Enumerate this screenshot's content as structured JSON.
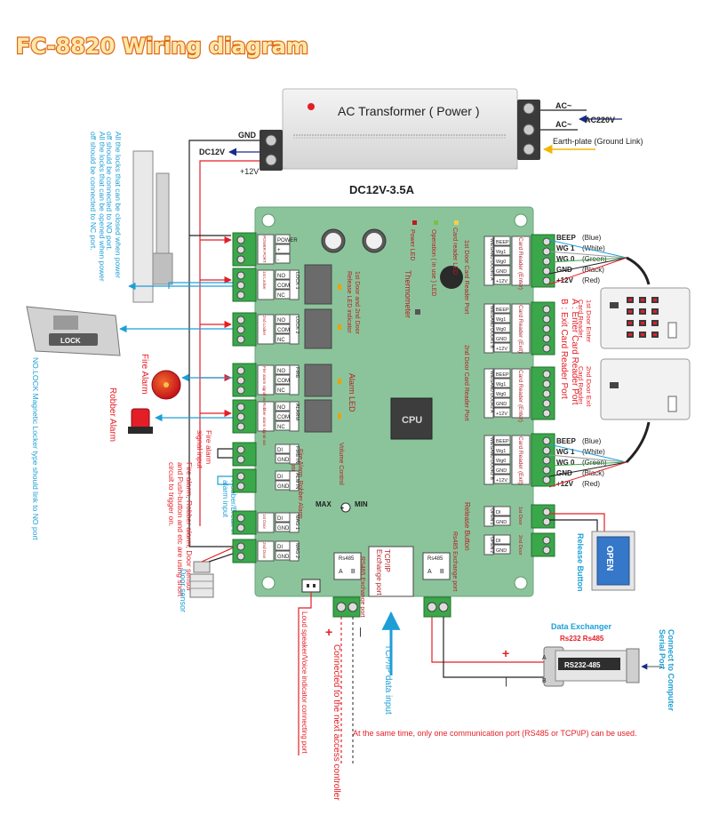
{
  "title": "FC-8820 Wiring diagram",
  "transformer": {
    "label": "AC Transformer ( Power )",
    "rating": "DC12V-3.5A",
    "left_terminals": {
      "gnd": "GND",
      "dc12v": "DC12V",
      "plus12v": "+12V"
    },
    "right_labels": {
      "ac1": "AC~",
      "ac2": "AC~",
      "ac220": "AC220V",
      "earth": "Earth-plate (Ground Link)"
    }
  },
  "left_notes": {
    "nc_note": "All the locks that can be opened when power off should be connected to NC port",
    "no_note": "All the locks that can be closed when power off should be connected to NO port.",
    "nolock_note": "NO.LOCK Magnetic Locker type should link to NO port",
    "lock_label": "LOCK",
    "fire_alarm": "Fire Alarm",
    "robber_alarm": "Robber Alarm",
    "fire_signal": "Fire alarm signal input",
    "robber_input": "Robber/Break-in alarm input",
    "trigger_note": "Fire alarm, Robber alarm, Door sensor and Push-button and etc are using short circuit to trigger on.",
    "door_sensor": "Door sensor"
  },
  "pcb": {
    "left_terminals": [
      {
        "id": "power",
        "pins": [
          "POWER",
          "+",
          "-"
        ],
        "side_label": "POWER PORT"
      },
      {
        "id": "lock1",
        "pins": [
          "NO",
          "COM",
          "NC"
        ],
        "side_label": "1st Locker",
        "tag": "LOCK 1"
      },
      {
        "id": "lock2",
        "pins": [
          "NO",
          "COM",
          "NC"
        ],
        "side_label": "2nd Locker",
        "tag": "LOCK 2"
      },
      {
        "id": "fire",
        "pins": [
          "NO",
          "COM",
          "NC"
        ],
        "side_label": "Fire alarm signal out",
        "tag": "FIRE"
      },
      {
        "id": "alarm",
        "pins": [
          "NO",
          "COM",
          "NC"
        ],
        "side_label": "Robber alarm signal out",
        "tag": "ALARM"
      },
      {
        "id": "firein",
        "pins": [
          "DI",
          "GND"
        ],
        "tag": "FIRE IN"
      },
      {
        "id": "alarmin",
        "pins": [
          "DI",
          "GND"
        ],
        "tag": "ALM IN"
      },
      {
        "id": "mag1",
        "pins": [
          "DI",
          "GND"
        ],
        "tag": "MAG 1",
        "side_label": "1st Door"
      },
      {
        "id": "mag2",
        "pins": [
          "DI",
          "GND"
        ],
        "tag": "MAG 2",
        "side_label": "2nd Door"
      }
    ],
    "right_terminals": [
      {
        "id": "reader1a",
        "pins": [
          "BEEP",
          "Wg1",
          "Wg0",
          "GND",
          "+12V"
        ],
        "tag": "WIEGAND DOOR1 A",
        "label": "Card Reader (Enter)"
      },
      {
        "id": "reader1b",
        "pins": [
          "BEEP",
          "Wg1",
          "Wg0",
          "GND",
          "+12V"
        ],
        "tag": "WIEGAND DOOR1 B",
        "label": "Card Reader (Exit)"
      },
      {
        "id": "reader2a",
        "pins": [
          "BEEP",
          "Wg1",
          "Wg0",
          "GND",
          "+12V"
        ],
        "tag": "WIEGAND DOOR2 A",
        "label": "Card Reader (Enter)"
      },
      {
        "id": "reader2b",
        "pins": [
          "BEEP",
          "Wg1",
          "Wg0",
          "GND",
          "+12V"
        ],
        "tag": "WIEGAND DOOR2 B",
        "label": "Card Reader (Exit)"
      },
      {
        "id": "open1",
        "pins": [
          "DI",
          "GND"
        ],
        "tag": "OPEN 1",
        "side_label": "1st Door"
      },
      {
        "id": "open2",
        "pins": [
          "DI",
          "GND"
        ],
        "tag": "OPEN 2",
        "side_label": "2nd Door"
      }
    ],
    "labels": {
      "power_led": "Power LED",
      "operation_led": "Operation ( in use ) LED",
      "card_reader_led": "Card reader LED",
      "relay_led": "1st Door and 2nd Door Release LED indicator",
      "thermometer": "Thermometer",
      "alarm_led": "Alarm LED",
      "cpu": "CPU",
      "fire_robber_port": "Fire Alarm, Robber Alarm data port",
      "volume_control": "Volume Control",
      "max": "MAX",
      "min": "MIN",
      "door1_reader_port": "1st Door Card Reader Port",
      "door2_reader_port": "2nd Door Card Reader Port",
      "release_button": "Release Button",
      "rs485_port_left": "RS485 Exchange port",
      "tcpip_port": "TCP/IP Exchange port",
      "rs485_port_right": "Rs485 Exchange port",
      "rs485_tag": "Rs485",
      "pin_a": "A",
      "pin_b": "B"
    }
  },
  "right_side": {
    "reader1_wires": [
      {
        "name": "BEEP",
        "color": "(Blue)"
      },
      {
        "name": "WG 1",
        "color": "(White)"
      },
      {
        "name": "WG 0",
        "color": "(Green)"
      },
      {
        "name": "GND",
        "color": "(Black)"
      },
      {
        "name": "+12V",
        "color": "(Red)"
      }
    ],
    "reader2_wires": [
      {
        "name": "BEEP",
        "color": "(Blue)"
      },
      {
        "name": "WG 1",
        "color": "(White)"
      },
      {
        "name": "WG 0",
        "color": "(Green)"
      },
      {
        "name": "GND",
        "color": "(Black)"
      },
      {
        "name": "+12V",
        "color": "(Red)"
      }
    ],
    "reader1_name": "1st Door Enter Card Reader",
    "reader2_name": "2nd Door Exit Card Reader",
    "port_legend_a": "A : Enter Card Reader Port",
    "port_legend_b": "B : Exit Card Reader Port",
    "open_button": "OPEN",
    "release_button": "Release Button"
  },
  "bottom": {
    "loudspeaker": "Loud speaker/Voice indicator connecting port",
    "plus": "+",
    "minus": "|",
    "next_controller": "Connected to the next access controller",
    "tcpip_input": "TCP/IP data input",
    "data_exchanger": "Data Exchanger",
    "rs232_rs485": "Rs232  Rs485",
    "converter_label": "RS232-485",
    "connect_computer": "Connect to Computer Serial Port",
    "note": "At the same time, only one communication port (RS485 or TCP\\IP) can be used."
  }
}
